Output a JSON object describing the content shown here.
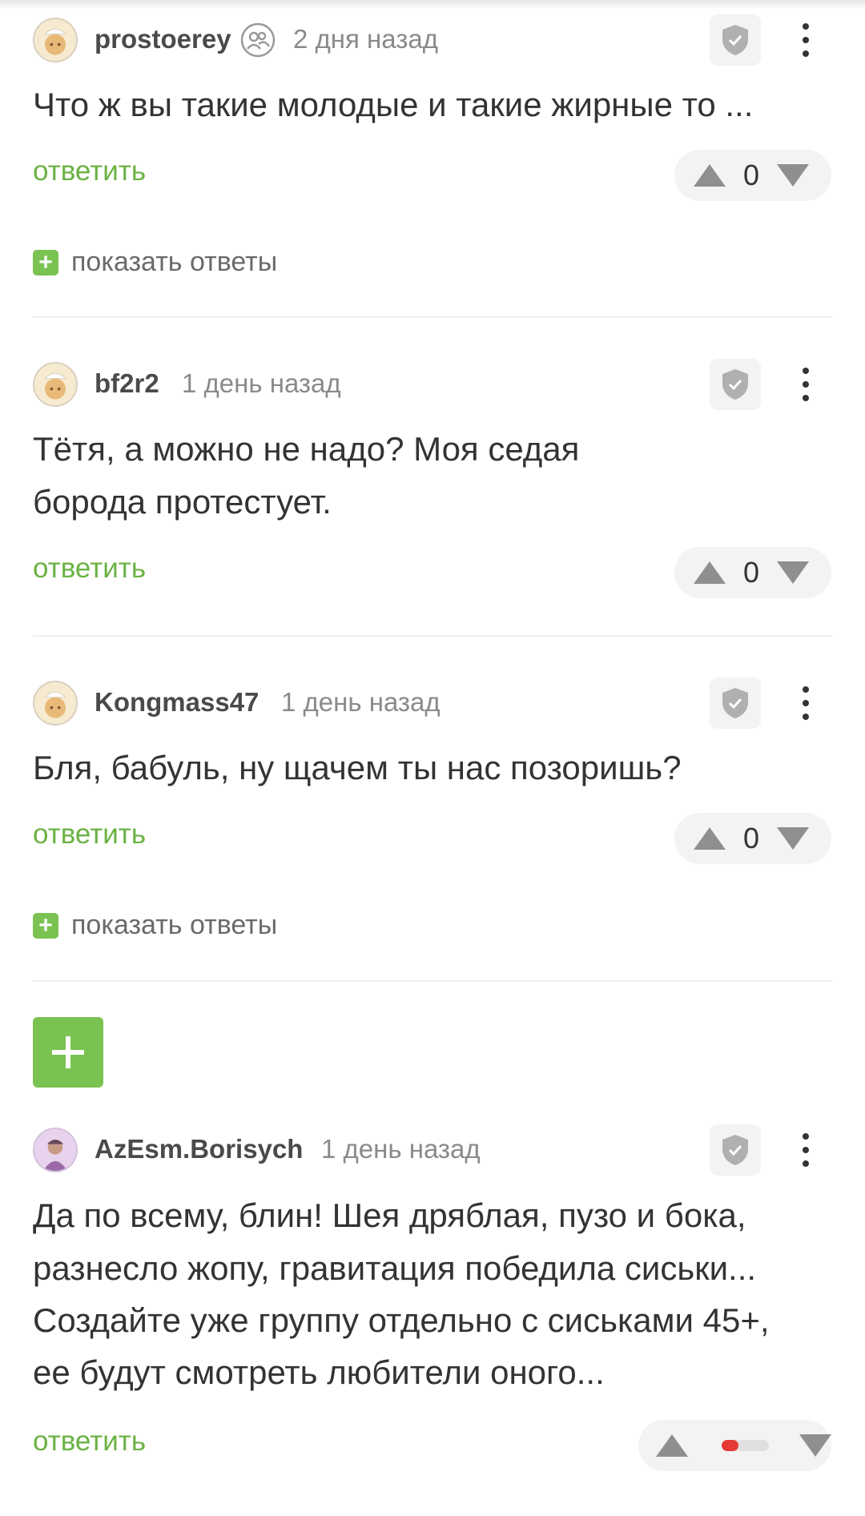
{
  "comments": [
    {
      "username": "prostoerey",
      "date": "2 дня назад",
      "has_group_icon": true,
      "text_lines": [
        "Что ж вы такие молодые и такие жирные то ..."
      ],
      "reply_label": "ответить",
      "score": "0",
      "show_replies_label": "показать ответы"
    },
    {
      "username": "bf2r2",
      "date": "1 день назад",
      "text_lines": [
        "Тётя, а можно не надо? Моя седая",
        "борода протестует."
      ],
      "reply_label": "ответить",
      "score": "0"
    },
    {
      "username": "Kongmass47",
      "date": "1 день назад",
      "text_lines": [
        "Бля, бабуль, ну щачем ты нас позоришь?"
      ],
      "reply_label": "ответить",
      "score": "0",
      "show_replies_label": "показать ответы"
    },
    {
      "username": "AzEsm.Borisych",
      "date": "1 день назад",
      "text_lines": [
        "Да по всему, блин! Шея дряблая, пузо и бока,",
        "разнесло жопу, гравитация победила сиськи...",
        "Создайте уже группу отдельно с сиськами 45+,",
        "ее будут смотреть любители оного..."
      ],
      "reply_label": "ответить",
      "rating_fraction": 0.35
    }
  ],
  "add_button": {
    "icon": "plus-icon"
  },
  "colors": {
    "accent_green": "#6bb244",
    "plus_green": "#7ac251",
    "negative_red": "#e53935"
  }
}
